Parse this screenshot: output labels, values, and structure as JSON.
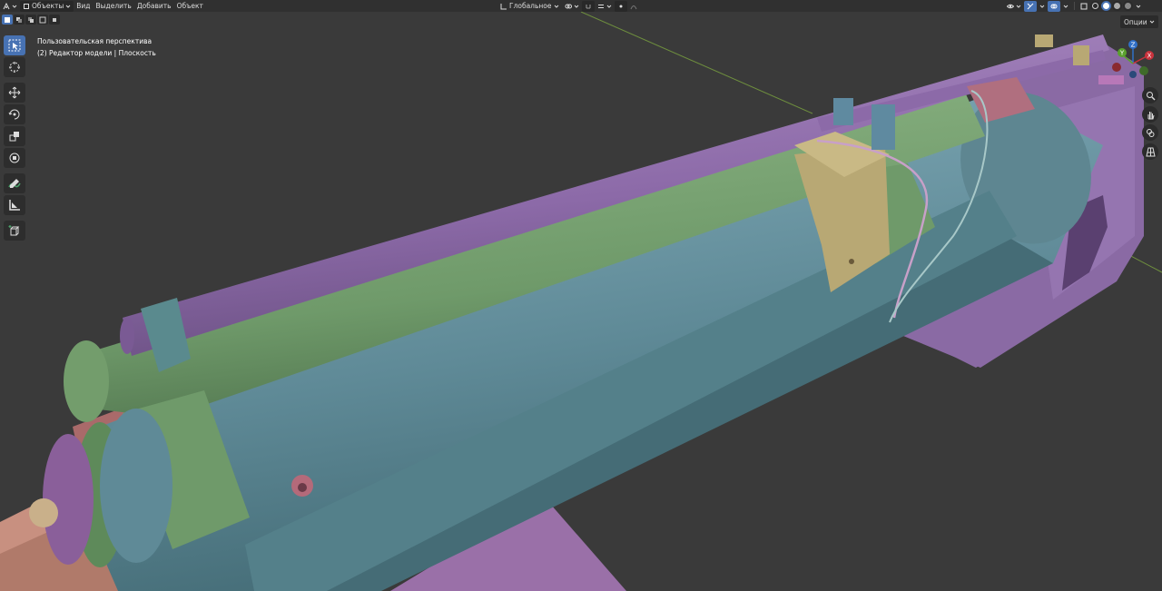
{
  "header": {
    "mode_label": "Объекты",
    "menu": [
      "Вид",
      "Выделить",
      "Добавить",
      "Объект"
    ],
    "orientation_label": "Глобальное"
  },
  "viewport": {
    "view_name": "Пользовательская перспектива",
    "collection_info": "(2) Редактор модели | Плоскость",
    "options_label": "Опции"
  },
  "gizmo": {
    "x_label": "X",
    "y_label": "Y",
    "z_label": "Z"
  },
  "tools": [
    {
      "name": "select-box",
      "icon": "cursor-icon",
      "active": true
    },
    {
      "name": "cursor",
      "icon": "3d-cursor-icon",
      "active": false
    },
    {
      "name": "move",
      "icon": "move-icon",
      "active": false
    },
    {
      "name": "rotate",
      "icon": "rotate-icon",
      "active": false
    },
    {
      "name": "scale",
      "icon": "scale-icon",
      "active": false
    },
    {
      "name": "transform",
      "icon": "transform-icon",
      "active": false
    },
    {
      "name": "annotate",
      "icon": "annotate-icon",
      "active": false
    },
    {
      "name": "measure",
      "icon": "measure-icon",
      "active": false
    },
    {
      "name": "add-cube",
      "icon": "add-cube-icon",
      "active": false
    }
  ],
  "colors": {
    "accent": "#4772b3",
    "background": "#3a3a3a",
    "header": "#303030",
    "purple": "#8c6aa8",
    "green": "#6f9a6a",
    "teal": "#5f8a95",
    "pink": "#a06a7a",
    "khaki": "#b8a874",
    "salmon": "#c08a7a"
  }
}
